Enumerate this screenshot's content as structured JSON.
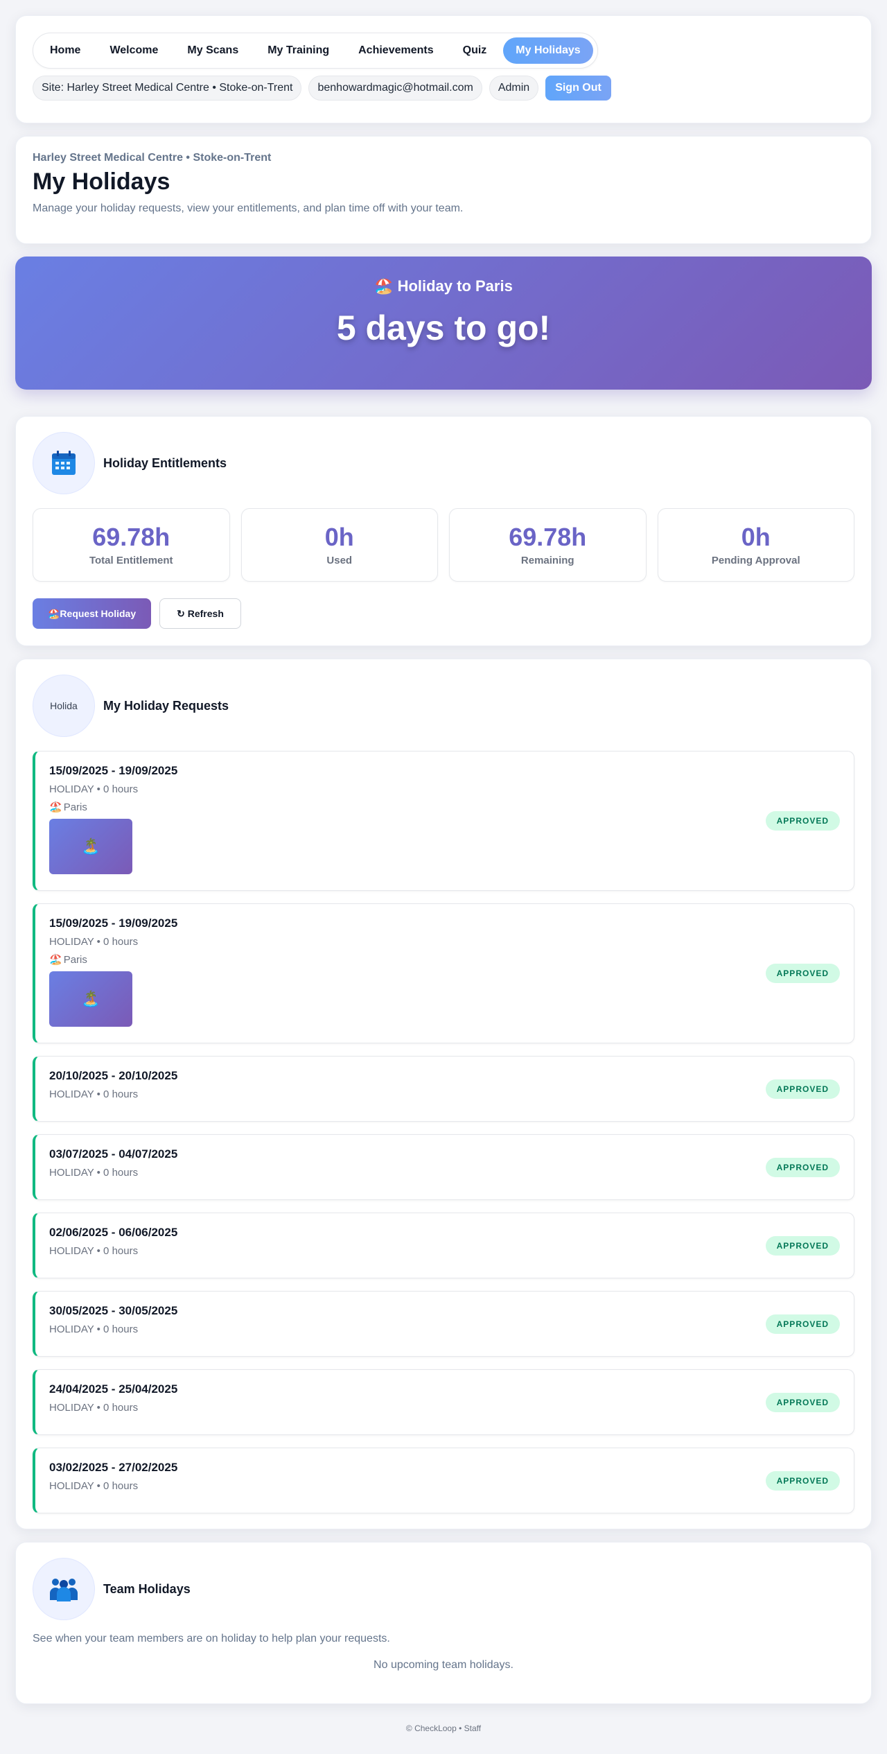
{
  "nav": {
    "links": [
      "Home",
      "Welcome",
      "My Scans",
      "My Training",
      "Achievements",
      "Quiz",
      "My Holidays"
    ],
    "active_index": 6,
    "site_chip": "Site: Harley Street Medical Centre • Stoke-on-Trent",
    "email_chip": "benhowardmagic@hotmail.com",
    "role_chip": "Admin",
    "signout_label": "Sign Out"
  },
  "header": {
    "site_line": "Harley Street Medical Centre • Stoke-on-Trent",
    "title": "My Holidays",
    "description": "Manage your holiday requests, view your entitlements, and plan time off with your team."
  },
  "countdown": {
    "emoji": "🏖️",
    "title": "Holiday to Paris",
    "days_text": "5 days to go!"
  },
  "entitlements": {
    "title": "Holiday Entitlements",
    "icon": "calendar-icon",
    "stats": [
      {
        "value": "69.78h",
        "label": "Total Entitlement"
      },
      {
        "value": "0h",
        "label": "Used"
      },
      {
        "value": "69.78h",
        "label": "Remaining"
      },
      {
        "value": "0h",
        "label": "Pending Approval"
      }
    ],
    "request_button": "🏖️Request Holiday",
    "refresh_button": "↻ Refresh"
  },
  "requests": {
    "title": "My Holiday Requests",
    "icon_alt": "Holida",
    "items": [
      {
        "dates": "15/09/2025 - 19/09/2025",
        "meta": "HOLIDAY • 0 hours",
        "location": "Paris",
        "has_image": true,
        "status": "APPROVED"
      },
      {
        "dates": "15/09/2025 - 19/09/2025",
        "meta": "HOLIDAY • 0 hours",
        "location": "Paris",
        "has_image": true,
        "status": "APPROVED"
      },
      {
        "dates": "20/10/2025 - 20/10/2025",
        "meta": "HOLIDAY • 0 hours",
        "status": "APPROVED"
      },
      {
        "dates": "03/07/2025 - 04/07/2025",
        "meta": "HOLIDAY • 0 hours",
        "status": "APPROVED"
      },
      {
        "dates": "02/06/2025 - 06/06/2025",
        "meta": "HOLIDAY • 0 hours",
        "status": "APPROVED"
      },
      {
        "dates": "30/05/2025 - 30/05/2025",
        "meta": "HOLIDAY • 0 hours",
        "status": "APPROVED"
      },
      {
        "dates": "24/04/2025 - 25/04/2025",
        "meta": "HOLIDAY • 0 hours",
        "status": "APPROVED"
      },
      {
        "dates": "03/02/2025 - 27/02/2025",
        "meta": "HOLIDAY • 0 hours",
        "status": "APPROVED"
      }
    ],
    "location_emoji": "🏖️",
    "image_emoji": "🏝️"
  },
  "team": {
    "title": "Team Holidays",
    "icon": "team-icon",
    "description": "See when your team members are on holiday to help plan your requests.",
    "empty_text": "No upcoming team holidays."
  },
  "footer": {
    "text": "© CheckLoop • Staff"
  }
}
